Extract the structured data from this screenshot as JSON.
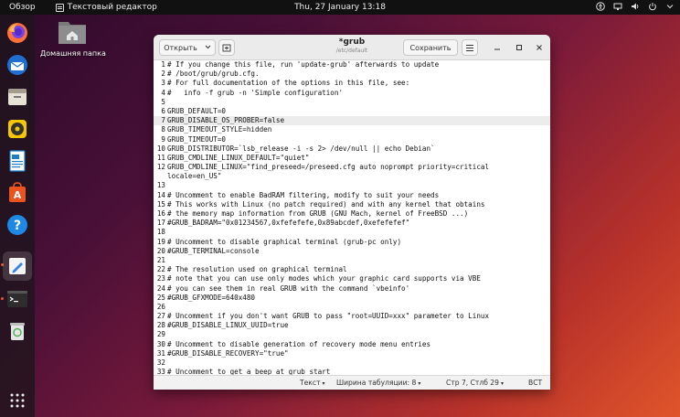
{
  "topbar": {
    "activities": "Обзор",
    "app_name": "Текстовый редактор",
    "clock": "Thu, 27 January  13:18"
  },
  "desktop": {
    "home_folder_label": "Домашняя папка"
  },
  "window": {
    "open_label": "Открыть",
    "title": "*grub",
    "subtitle": "/etc/default",
    "save_label": "Сохранить"
  },
  "editor": {
    "current_line": 7,
    "lines": [
      {
        "n": "1",
        "text": "# If you change this file, run 'update-grub' afterwards to update"
      },
      {
        "n": "2",
        "text": "# /boot/grub/grub.cfg."
      },
      {
        "n": "3",
        "text": "# For full documentation of the options in this file, see:"
      },
      {
        "n": "4",
        "text": "#   info -f grub -n 'Simple configuration'"
      },
      {
        "n": "5",
        "text": ""
      },
      {
        "n": "6",
        "text": "GRUB_DEFAULT=0"
      },
      {
        "n": "7",
        "text": "GRUB_DISABLE_OS_PROBER=false"
      },
      {
        "n": "8",
        "text": "GRUB_TIMEOUT_STYLE=hidden"
      },
      {
        "n": "9",
        "text": "GRUB_TIMEOUT=0"
      },
      {
        "n": "10",
        "text": "GRUB_DISTRIBUTOR=`lsb_release -i -s 2> /dev/null || echo Debian`"
      },
      {
        "n": "11",
        "text": "GRUB_CMDLINE_LINUX_DEFAULT=\"quiet\""
      },
      {
        "n": "12",
        "text": "GRUB_CMDLINE_LINUX=\"find_preseed=/preseed.cfg auto noprompt priority=critical"
      },
      {
        "n": "",
        "text": "locale=en_US\""
      },
      {
        "n": "13",
        "text": ""
      },
      {
        "n": "14",
        "text": "# Uncomment to enable BadRAM filtering, modify to suit your needs"
      },
      {
        "n": "15",
        "text": "# This works with Linux (no patch required) and with any kernel that obtains"
      },
      {
        "n": "16",
        "text": "# the memory map information from GRUB (GNU Mach, kernel of FreeBSD ...)"
      },
      {
        "n": "17",
        "text": "#GRUB_BADRAM=\"0x01234567,0xfefefefe,0x89abcdef,0xefefefef\""
      },
      {
        "n": "18",
        "text": ""
      },
      {
        "n": "19",
        "text": "# Uncomment to disable graphical terminal (grub-pc only)"
      },
      {
        "n": "20",
        "text": "#GRUB_TERMINAL=console"
      },
      {
        "n": "21",
        "text": ""
      },
      {
        "n": "22",
        "text": "# The resolution used on graphical terminal"
      },
      {
        "n": "23",
        "text": "# note that you can use only modes which your graphic card supports via VBE"
      },
      {
        "n": "24",
        "text": "# you can see them in real GRUB with the command `vbeinfo'"
      },
      {
        "n": "25",
        "text": "#GRUB_GFXMODE=640x480"
      },
      {
        "n": "26",
        "text": ""
      },
      {
        "n": "27",
        "text": "# Uncomment if you don't want GRUB to pass \"root=UUID=xxx\" parameter to Linux"
      },
      {
        "n": "28",
        "text": "#GRUB_DISABLE_LINUX_UUID=true"
      },
      {
        "n": "29",
        "text": ""
      },
      {
        "n": "30",
        "text": "# Uncomment to disable generation of recovery mode menu entries"
      },
      {
        "n": "31",
        "text": "#GRUB_DISABLE_RECOVERY=\"true\""
      },
      {
        "n": "32",
        "text": ""
      },
      {
        "n": "33",
        "text": "# Uncomment to get a beep at grub start"
      }
    ]
  },
  "statusbar": {
    "language": "Текст",
    "tab_width": "Ширина табуляции: 8",
    "position": "Стр 7, Стлб 29",
    "mode": "ВСТ"
  }
}
